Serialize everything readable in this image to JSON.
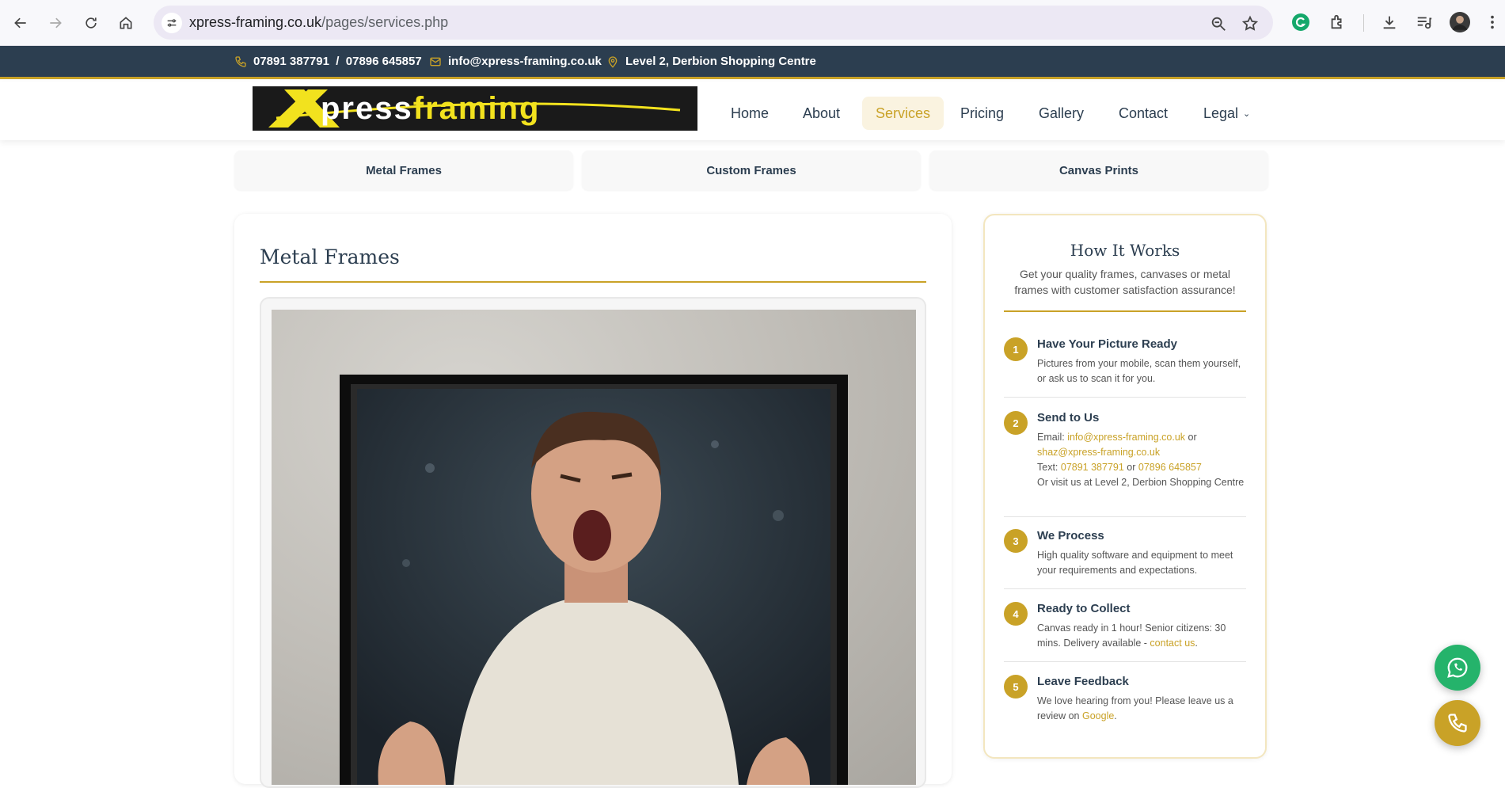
{
  "browser": {
    "url_host": "xpress-framing.co.uk",
    "url_path": "/pages/services.php"
  },
  "topbar": {
    "phone": "07891 387791  /  07896 645857",
    "email": "info@xpress-framing.co.uk",
    "address": "Level 2, Derbion Shopping Centre"
  },
  "logo": {
    "first": "X",
    "press": "press",
    "framing": "framing"
  },
  "nav": {
    "items": [
      {
        "label": "Home"
      },
      {
        "label": "About"
      },
      {
        "label": "Services"
      },
      {
        "label": "Pricing"
      },
      {
        "label": "Gallery"
      },
      {
        "label": "Contact"
      },
      {
        "label": "Legal"
      }
    ],
    "active": "Services"
  },
  "service_tabs": [
    {
      "label": "Metal Frames"
    },
    {
      "label": "Custom Frames"
    },
    {
      "label": "Canvas Prints"
    }
  ],
  "main": {
    "title": "Metal Frames"
  },
  "sidebar": {
    "title": "How It Works",
    "subtitle": "Get your quality frames, canvases or metal frames with customer satisfaction assurance!",
    "steps": [
      {
        "num": "1",
        "title": "Have Your Picture Ready",
        "text": "Pictures from your mobile, scan them yourself, or ask us to scan it for you."
      },
      {
        "num": "2",
        "title": "Send to Us",
        "email_prefix": "Email: ",
        "email1": "info@xpress-framing.co.uk",
        "or1": " or",
        "email2": "shaz@xpress-framing.co.uk",
        "text_prefix": "Text: ",
        "phone1": "07891 387791",
        "or2": " or ",
        "phone2": "07896 645857",
        "visit": "Or visit us at Level 2, Derbion Shopping Centre"
      },
      {
        "num": "3",
        "title": "We Process",
        "text": "High quality software and equipment to meet your requirements and expectations."
      },
      {
        "num": "4",
        "title": "Ready to Collect",
        "text": "Canvas ready in 1 hour! Senior citizens: 30 mins. Delivery available - ",
        "link": "contact us",
        "end": "."
      },
      {
        "num": "5",
        "title": "Leave Feedback",
        "text": "We love hearing from you! Please leave us a review on ",
        "link": "Google",
        "end": "."
      }
    ]
  },
  "colors": {
    "navy": "#2c3e50",
    "gold": "#c9a227",
    "whatsapp": "#25b36b"
  }
}
